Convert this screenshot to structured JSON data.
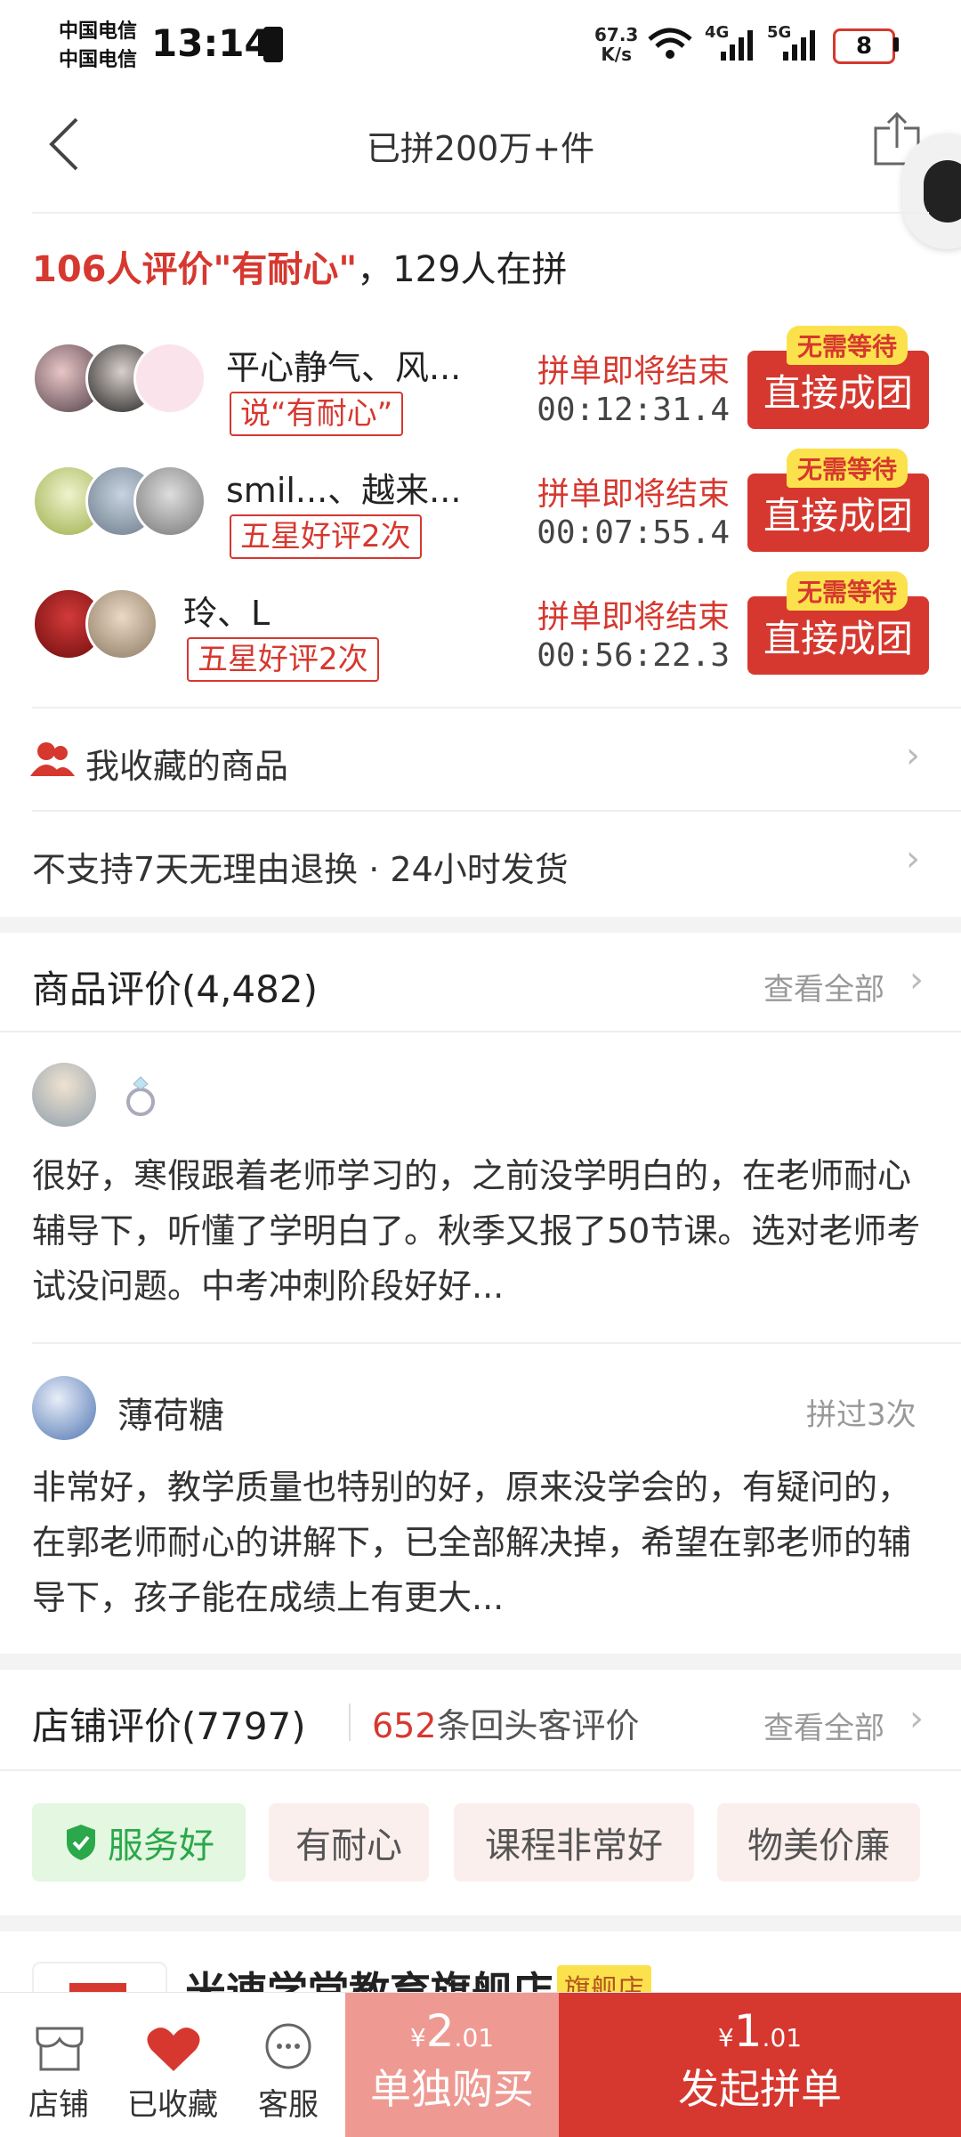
{
  "status_bar": {
    "carrier1": "中国电信",
    "carrier2": "中国电信",
    "time": "13:14",
    "net_speed_top": "67.3",
    "net_speed_unit": "K/s",
    "net1": "4G",
    "net2": "5G",
    "battery": "8"
  },
  "nav": {
    "title": "已拼200万+件"
  },
  "group": {
    "head_count_text": "106人评价\"有耐心\"",
    "head_suffix": "，129人在拼",
    "no_wait": "无需等待",
    "join_label": "直接成团",
    "ending_label": "拼单即将结束",
    "rows": [
      {
        "name": "平心静气、风...",
        "tag": "说“有耐心”",
        "timer": "00:12:31.4"
      },
      {
        "name": "smil...、越来...",
        "tag": "五星好评2次",
        "timer": "00:07:55.4"
      },
      {
        "name": "玲、L",
        "tag": "五星好评2次",
        "timer": "00:56:22.3"
      }
    ]
  },
  "favorites_row": {
    "label": "我收藏的商品"
  },
  "service_row": {
    "label": "不支持7天无理由退换 · 24小时发货"
  },
  "product_reviews": {
    "title": "商品评价(4,482)",
    "view_all": "查看全部",
    "items": [
      {
        "user": "",
        "badge": "",
        "text": "很好，寒假跟着老师学习的，之前没学明白的，在老师耐心辅导下，听懂了学明白了。秋季又报了50节课。选对老师考试没问题。中考冲刺阶段好好..."
      },
      {
        "user": "薄荷糖",
        "badge": "拼过3次",
        "text": "非常好，教学质量也特别的好，原来没学会的，有疑问的，在郭老师耐心的讲解下，已全部解决掉，希望在郭老师的辅导下，孩子能在成绩上有更大..."
      }
    ]
  },
  "store_reviews": {
    "title": "店铺评价(7797)",
    "returning_count": "652",
    "returning_label": "条回头客评价",
    "view_all": "查看全部",
    "chips": [
      "服务好",
      "有耐心",
      "课程非常好",
      "物美价廉"
    ]
  },
  "store_peek": {
    "name": "米速学堂教育旗舰店",
    "badge": "旗舰店"
  },
  "bottom": {
    "store": "店铺",
    "favorited": "已收藏",
    "service": "客服",
    "single_price_currency": "¥",
    "single_price_int": "2",
    "single_price_dec": ".01",
    "single_label": "单独购买",
    "group_price_currency": "¥",
    "group_price_int": "1",
    "group_price_dec": ".01",
    "group_label": "发起拼单"
  },
  "colors": {
    "accent": "#d6382f",
    "green": "#2aa84a",
    "chip_bg": "#fbefed",
    "chip_green_bg": "#e4f7e1"
  }
}
